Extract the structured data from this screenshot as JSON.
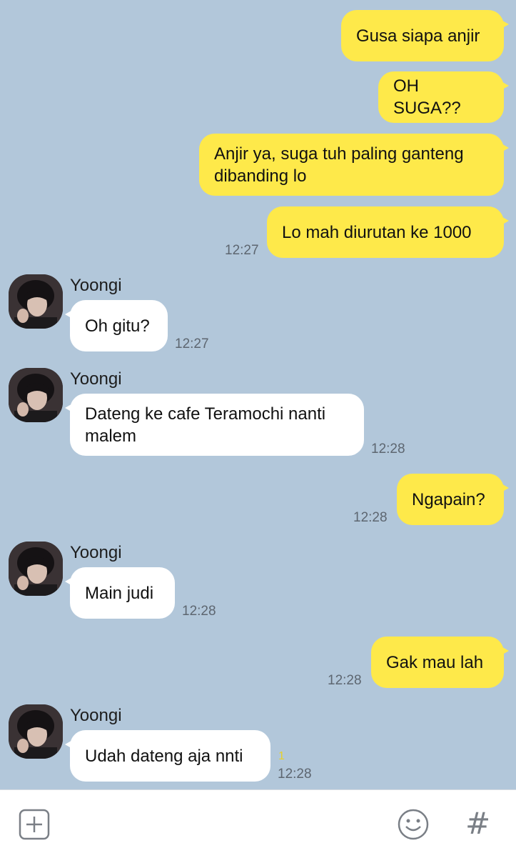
{
  "contact_name": "Yoongi",
  "messages": [
    {
      "text": "Gusa siapa anjir"
    },
    {
      "text": "OH SUGA??"
    },
    {
      "text": "Anjir ya, suga tuh paling ganteng\ndibanding lo"
    },
    {
      "text": "Lo mah diurutan ke 1000",
      "time": "12:27"
    },
    {
      "text": "Oh gitu?",
      "time": "12:27"
    },
    {
      "text": "Dateng ke cafe Teramochi nanti\nmalem",
      "time": "12:28"
    },
    {
      "text": "Ngapain?",
      "time": "12:28"
    },
    {
      "text": "Main judi",
      "time": "12:28"
    },
    {
      "text": "Gak mau lah",
      "time": "12:28"
    },
    {
      "text": "Udah dateng aja nnti",
      "time": "12:28",
      "unread": "1"
    }
  ],
  "input_bar": {
    "left_icon": "plus-box-icon",
    "right_icons": [
      "emoji-icon",
      "hashtag-icon"
    ],
    "hashtag_glyph": "#"
  },
  "colors": {
    "background": "#b2c7da",
    "outgoing_bubble": "#fee94a",
    "incoming_bubble": "#ffffff"
  }
}
